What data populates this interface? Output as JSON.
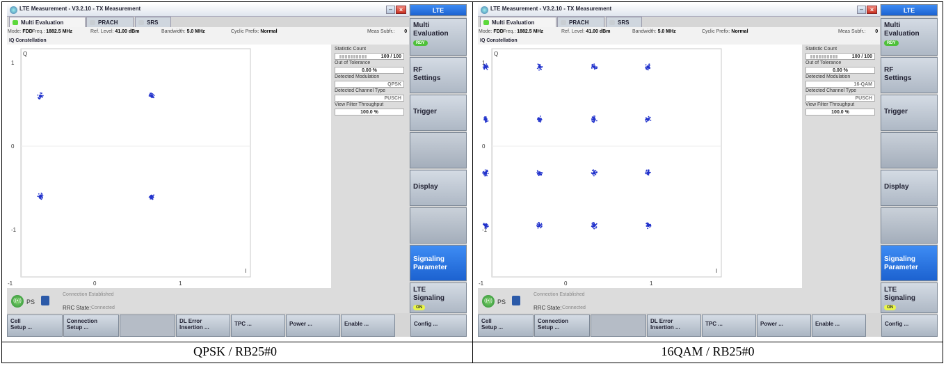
{
  "panels": [
    {
      "caption": "QPSK / RB25#0",
      "window_title": "LTE Measurement - V3.2.10 - TX Measurement",
      "tabs": [
        "Multi Evaluation",
        "PRACH",
        "SRS"
      ],
      "info": {
        "mode_label": "Mode:",
        "mode": "FDD",
        "freq_label": "Freq.:",
        "freq": "1882.5 MHz",
        "ref_label": "Ref. Level:",
        "ref": "41.00 dBm",
        "bw_label": "Bandwidth:",
        "bw": "5.0 MHz",
        "cp_label": "Cyclic Prefix:",
        "cp": "Normal",
        "subfr_label": "Meas Subfr.:",
        "subfr": "0"
      },
      "section_title": "IQ Constellation",
      "axis": {
        "q_label": "Q",
        "i_label": "I",
        "x_ticks": [
          "-1",
          "0",
          "1"
        ],
        "y_ticks": [
          "1",
          "0",
          "-1"
        ]
      },
      "stats": {
        "count_label": "Statistic Count",
        "count_value": "100 / 100",
        "tol_label": "Out of Tolerance",
        "tol_value": "0.00 %",
        "mod_label": "Detected Modulation",
        "mod_value": "QPSK",
        "chan_label": "Detected Channel Type",
        "chan_value": "PUSCH",
        "thru_label": "View Filter Throughput",
        "thru_value": "100.0 %"
      },
      "status": {
        "ps_label": "PS",
        "conn_text": "Connection Established",
        "rrc_label": "RRC State:",
        "rrc_value": "Connected"
      },
      "softkeys": {
        "lte": "LTE",
        "multi": "Multi Evaluation",
        "multi_badge": "RDY",
        "rf": "RF Settings",
        "trigger": "Trigger",
        "display": "Display",
        "sig_param": "Signaling Parameter",
        "lte_sig": "LTE Signaling",
        "lte_sig_badge": "ON"
      },
      "bottom_keys": [
        "Cell\nSetup ...",
        "Connection\nSetup ...",
        "",
        "DL Error\nInsertion ...",
        "TPC ...",
        "Power ...",
        "Enable ...",
        "Config ..."
      ],
      "constellation": {
        "modulation": "QPSK",
        "points_iq": [
          [
            -0.65,
            0.6
          ],
          [
            0.65,
            0.6
          ],
          [
            -0.65,
            -0.6
          ],
          [
            0.65,
            -0.6
          ]
        ]
      }
    },
    {
      "caption": "16QAM / RB25#0",
      "window_title": "LTE Measurement - V3.2.10 - TX Measurement",
      "tabs": [
        "Multi Evaluation",
        "PRACH",
        "SRS"
      ],
      "info": {
        "mode_label": "Mode:",
        "mode": "FDD",
        "freq_label": "Freq.:",
        "freq": "1882.5 MHz",
        "ref_label": "Ref. Level:",
        "ref": "41.00 dBm",
        "bw_label": "Bandwidth:",
        "bw": "5.0 MHz",
        "cp_label": "Cyclic Prefix:",
        "cp": "Normal",
        "subfr_label": "Meas Subfr.:",
        "subfr": "0"
      },
      "section_title": "IQ Constellation",
      "axis": {
        "q_label": "Q",
        "i_label": "I",
        "x_ticks": [
          "-1",
          "0",
          "1"
        ],
        "y_ticks": [
          "1",
          "0",
          "-1"
        ]
      },
      "stats": {
        "count_label": "Statistic Count",
        "count_value": "100 / 100",
        "tol_label": "Out of Tolerance",
        "tol_value": "0.00 %",
        "mod_label": "Detected Modulation",
        "mod_value": "16-QAM",
        "chan_label": "Detected Channel Type",
        "chan_value": "PUSCH",
        "thru_label": "View Filter Throughput",
        "thru_value": "100.0 %"
      },
      "status": {
        "ps_label": "PS",
        "conn_text": "Connection Established",
        "rrc_label": "RRC State:",
        "rrc_value": "Connected"
      },
      "softkeys": {
        "lte": "LTE",
        "multi": "Multi Evaluation",
        "multi_badge": "RDY",
        "rf": "RF Settings",
        "trigger": "Trigger",
        "display": "Display",
        "sig_param": "Signaling Parameter",
        "lte_sig": "LTE Signaling",
        "lte_sig_badge": "ON"
      },
      "bottom_keys": [
        "Cell\nSetup ...",
        "Connection\nSetup ...",
        "",
        "DL Error\nInsertion ...",
        "TPC ...",
        "Power ...",
        "Enable ...",
        "Config ..."
      ],
      "constellation": {
        "modulation": "16-QAM",
        "points_iq": [
          [
            -0.95,
            0.95
          ],
          [
            -0.32,
            0.95
          ],
          [
            0.32,
            0.95
          ],
          [
            0.95,
            0.95
          ],
          [
            -0.95,
            0.32
          ],
          [
            -0.32,
            0.32
          ],
          [
            0.32,
            0.32
          ],
          [
            0.95,
            0.32
          ],
          [
            -0.95,
            -0.32
          ],
          [
            -0.32,
            -0.32
          ],
          [
            0.32,
            -0.32
          ],
          [
            0.95,
            -0.32
          ],
          [
            -0.95,
            -0.95
          ],
          [
            -0.32,
            -0.95
          ],
          [
            0.32,
            -0.95
          ],
          [
            0.95,
            -0.95
          ]
        ]
      }
    }
  ],
  "colors": {
    "constellation_point": "#2233cc",
    "softkey_active": "#1c62d0",
    "ready_badge": "#e8f54a"
  }
}
